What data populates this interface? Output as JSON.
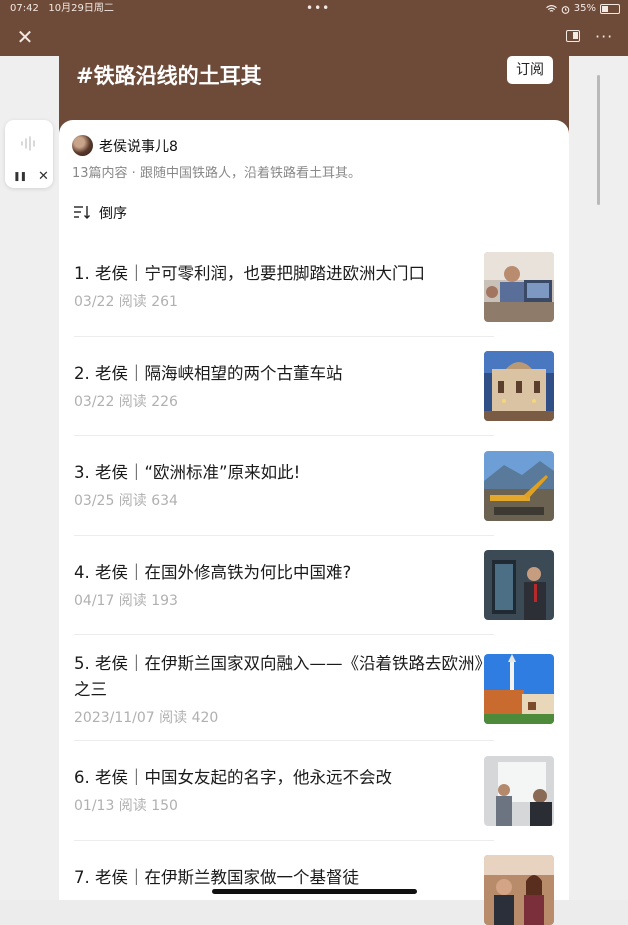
{
  "status_bar": {
    "time": "07:42",
    "date": "10月29日周二",
    "dots": "•••",
    "battery_text": "35%",
    "battery_level": 0.35
  },
  "nav": {
    "close_icon": "close-icon",
    "more_icon": "more-icon",
    "more_glyph": "···",
    "close_glyph": "✕"
  },
  "header": {
    "title": "#铁路沿线的土耳其",
    "subscribe_label": "订阅",
    "background_color": "#6e4a38"
  },
  "floating_player": {
    "pause_glyph": "❚❚",
    "close_glyph": "✕"
  },
  "author": {
    "name": "老侯说事儿8",
    "description": "13篇内容 · 跟随中国铁路人，沿着铁路看土耳其。"
  },
  "sort": {
    "label": "倒序"
  },
  "articles": [
    {
      "title": "1. 老侯｜宁可零利润，也要把脚踏进欧洲大门口",
      "meta": "03/22  阅读 261",
      "thumb_icon": "office-photo"
    },
    {
      "title": "2. 老侯｜隔海峡相望的两个古董车站",
      "meta": "03/22  阅读 226",
      "thumb_icon": "station-photo"
    },
    {
      "title": "3. 老侯｜“欧洲标准”原来如此!",
      "meta": "03/25  阅读 634",
      "thumb_icon": "construction-photo"
    },
    {
      "title": "4. 老侯｜在国外修高铁为何比中国难?",
      "meta": "04/17  阅读 193",
      "thumb_icon": "meeting-photo"
    },
    {
      "title": "5. 老侯｜在伊斯兰国家双向融入——《沿着铁路去欧洲》之三",
      "meta": "2023/11/07  阅读 420",
      "thumb_icon": "mosque-photo"
    },
    {
      "title": "6. 老侯｜中国女友起的名字，他永远不会改",
      "meta": "01/13  阅读 150",
      "thumb_icon": "whiteboard-photo"
    },
    {
      "title": "7. 老侯｜在伊斯兰教国家做一个基督徒",
      "meta": "",
      "thumb_icon": "people-photo"
    }
  ]
}
